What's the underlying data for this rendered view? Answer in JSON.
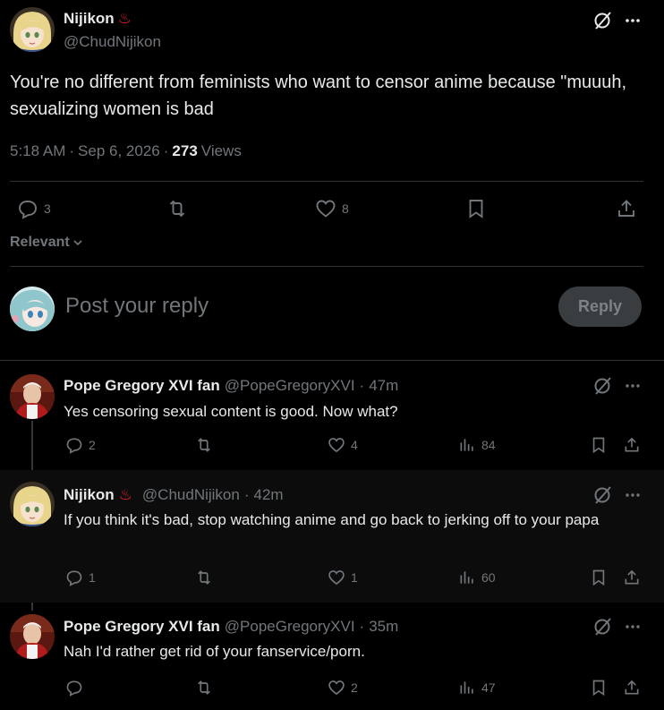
{
  "main_tweet": {
    "author_name": "Nijikon",
    "author_emoji": "♨",
    "handle": "@ChudNijikon",
    "text": "You're no different from feminists who want to censor anime because \"muuuh, sexualizing women is bad",
    "time": "5:18 AM",
    "date": "Sep 6, 2026",
    "views_count": "273",
    "views_label": "Views",
    "replies": "3",
    "likes": "8"
  },
  "sort": {
    "label": "Relevant"
  },
  "composer": {
    "placeholder": "Post your reply",
    "button_label": "Reply"
  },
  "replies": [
    {
      "name": "Pope Gregory XVI fan",
      "handle": "@PopeGregoryXVI",
      "time": "47m",
      "text": "Yes censoring sexual content is good. Now what?",
      "replies": "2",
      "likes": "4",
      "views": "84"
    },
    {
      "name": "Nijikon",
      "emoji": "♨",
      "handle": "@ChudNijikon",
      "time": "42m",
      "text": "If you think it's bad, stop watching anime and go back to jerking off to your papa",
      "replies": "1",
      "likes": "1",
      "views": "60"
    },
    {
      "name": "Pope Gregory XVI fan",
      "handle": "@PopeGregoryXVI",
      "time": "35m",
      "text": "Nah I'd rather get rid of your fanservice/porn.",
      "replies": "",
      "likes": "2",
      "views": "47"
    }
  ],
  "separator": "·",
  "colors": {
    "background": "#000000",
    "text": "#e7e9ea",
    "muted": "#71767b",
    "divider": "#2f3336",
    "highlighted_row": "#0d0d0d",
    "emoji": "#f4212e"
  }
}
